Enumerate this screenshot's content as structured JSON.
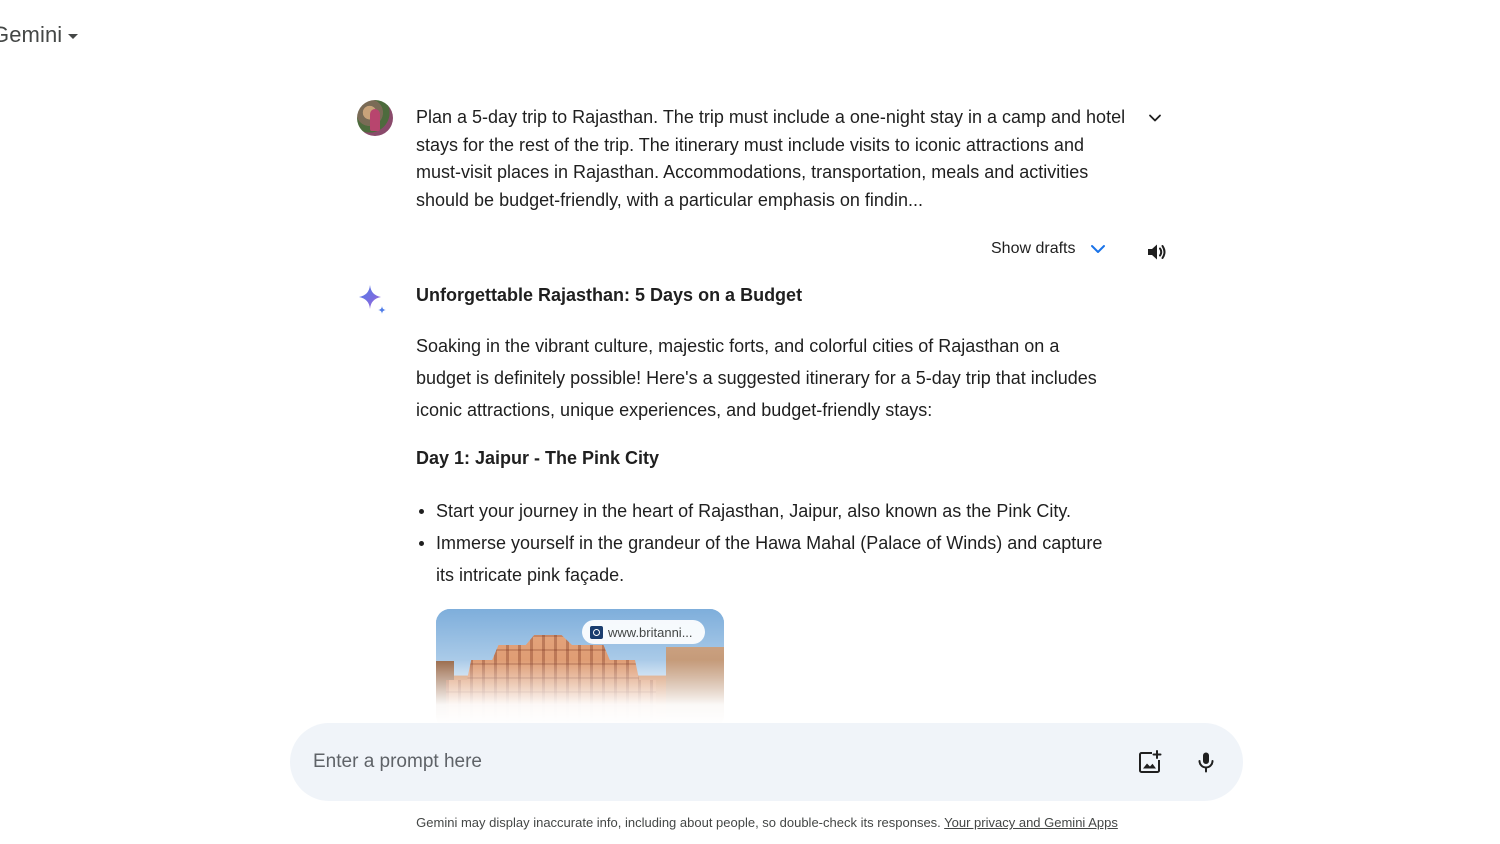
{
  "app": {
    "name": "Gemini"
  },
  "conversation": {
    "user_prompt": "Plan a 5-day trip to Rajasthan. The trip must include a one-night stay in a camp and hotel stays for the rest of the trip. The itinerary must include visits to iconic attractions and must-visit places in Rajasthan. Accommodations, transportation, meals and activities should be budget-friendly, with a particular emphasis on findin...",
    "show_drafts_label": "Show drafts",
    "response": {
      "title": "Unforgettable Rajasthan: 5 Days on a Budget",
      "intro": "Soaking in the vibrant culture, majestic forts, and colorful cities of Rajasthan on a budget is definitely possible! Here's a suggested itinerary for a 5-day trip that includes iconic attractions, unique experiences, and budget-friendly stays:",
      "day1_title": "Day 1: Jaipur - The Pink City",
      "day1_bullets": [
        "Start your journey in the heart of Rajasthan, Jaipur, also known as the Pink City.",
        "Immerse yourself in the grandeur of the Hawa Mahal (Palace of Winds) and capture its intricate pink façade."
      ],
      "image_source": "www.britanni..."
    }
  },
  "input": {
    "placeholder": "Enter a prompt here",
    "value": ""
  },
  "footer": {
    "disclaimer": "Gemini may display inaccurate info, including about people, so double-check its responses. ",
    "privacy_link": "Your privacy and Gemini Apps"
  },
  "icons": {
    "brand_caret": "caret-down-icon",
    "expand": "chevron-down-icon",
    "drafts": "chevron-down-icon",
    "speaker": "volume-icon",
    "spark": "gemini-sparkle-icon",
    "image_upload": "add-image-icon",
    "mic": "microphone-icon"
  },
  "colors": {
    "accent_blue": "#1a73e8",
    "input_bg": "#f0f4f9",
    "text": "#1f1f1f",
    "muted": "#444746"
  }
}
